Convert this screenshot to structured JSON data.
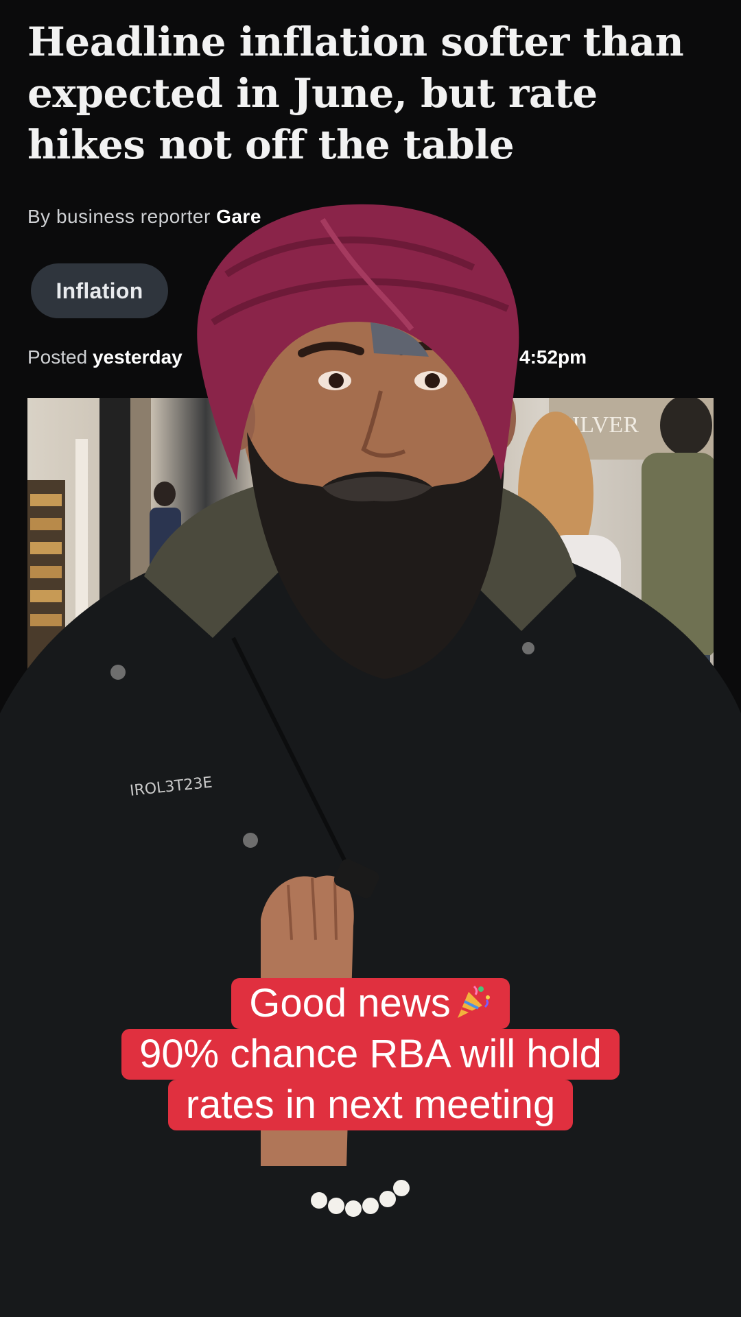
{
  "article": {
    "headline": "Headline inflation softer than expected in June, but rate hikes not off the table",
    "byline_prefix": "By business reporter",
    "byline_name": "Gare",
    "tag": "Inflation",
    "posted_label": "Posted",
    "posted_when": "yesterday",
    "updated_time_fragment": "4:52pm"
  },
  "caption": {
    "line1": "Good news",
    "line1_emoji": "party-popper-icon",
    "line2": "90% chance RBA will hold",
    "line3": "rates in next meeting"
  },
  "colors": {
    "background": "#0b0b0c",
    "caption_bg": "#e0303f",
    "tag_bg": "#2f353d",
    "turban": "#8a2449",
    "jacket": "#17191b"
  }
}
